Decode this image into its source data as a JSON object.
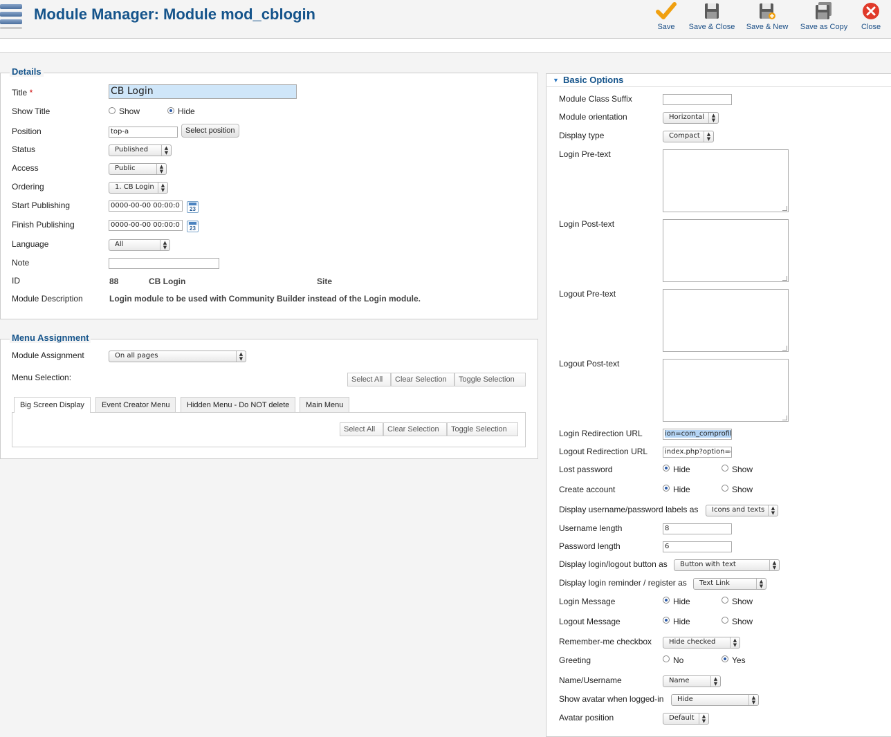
{
  "header": {
    "title": "Module Manager: Module mod_cblogin",
    "toolbar": {
      "save": "Save",
      "save_close": "Save & Close",
      "save_new": "Save & New",
      "save_copy": "Save as Copy",
      "close": "Close"
    }
  },
  "details": {
    "legend": "Details",
    "title_label": "Title",
    "required_mark": "*",
    "title_value": "CB Login",
    "show_title_label": "Show Title",
    "show_title_options": [
      "Show",
      "Hide"
    ],
    "show_title_selected": "Hide",
    "position_label": "Position",
    "position_value": "top-a",
    "select_position_button": "Select position",
    "status_label": "Status",
    "status_value": "Published",
    "access_label": "Access",
    "access_value": "Public",
    "ordering_label": "Ordering",
    "ordering_value": "1. CB Login",
    "start_publishing_label": "Start Publishing",
    "start_publishing_value": "0000-00-00 00:00:0",
    "finish_publishing_label": "Finish Publishing",
    "finish_publishing_value": "0000-00-00 00:00:0",
    "calendar_icon_text": "23",
    "language_label": "Language",
    "language_value": "All",
    "note_label": "Note",
    "note_value": "",
    "id_label": "ID",
    "id_value": "88",
    "id_name": "CB Login",
    "id_client": "Site",
    "description_label": "Module Description",
    "description_value": "Login module to be used with Community Builder instead of the Login module."
  },
  "menu_assignment": {
    "legend": "Menu Assignment",
    "module_assignment_label": "Module Assignment",
    "module_assignment_value": "On all pages",
    "menu_selection_label": "Menu Selection:",
    "select_all": "Select All",
    "clear_selection": "Clear Selection",
    "toggle_selection": "Toggle Selection",
    "tabs": [
      "Big Screen Display",
      "Event Creator Menu",
      "Hidden Menu - Do NOT delete",
      "Main Menu"
    ],
    "active_tab": "Big Screen Display"
  },
  "basic_options": {
    "legend": "Basic Options",
    "module_class_suffix_label": "Module Class Suffix",
    "module_class_suffix_value": "",
    "module_orientation_label": "Module orientation",
    "module_orientation_value": "Horizontal",
    "display_type_label": "Display type",
    "display_type_value": "Compact",
    "login_pretext_label": "Login Pre-text",
    "login_posttext_label": "Login Post-text",
    "logout_pretext_label": "Logout Pre-text",
    "logout_posttext_label": "Logout Post-text",
    "login_redirection_label": "Login Redirection URL",
    "login_redirection_value": "ion=com_comprofil",
    "logout_redirection_label": "Logout Redirection URL",
    "logout_redirection_value": "index.php?option=c",
    "lost_password_label": "Lost password",
    "create_account_label": "Create account",
    "hide_option": "Hide",
    "show_option": "Show",
    "no_option": "No",
    "yes_option": "Yes",
    "display_labels_label": "Display username/password labels as",
    "display_labels_value": "Icons and texts",
    "username_length_label": "Username length",
    "username_length_value": "8",
    "password_length_label": "Password length",
    "password_length_value": "6",
    "display_button_label": "Display login/logout button as",
    "display_button_value": "Button with text",
    "display_reminder_label": "Display login reminder / register as",
    "display_reminder_value": "Text Link",
    "login_message_label": "Login Message",
    "logout_message_label": "Logout Message",
    "remember_me_label": "Remember-me checkbox",
    "remember_me_value": "Hide checked",
    "greeting_label": "Greeting",
    "name_username_label": "Name/Username",
    "name_username_value": "Name",
    "show_avatar_label": "Show avatar when logged-in",
    "show_avatar_value": "Hide",
    "avatar_position_label": "Avatar position",
    "avatar_position_value": "Default"
  },
  "colors": {
    "title_blue": "#15548b",
    "highlight_input": "#cfe6f9",
    "close_red": "#e03a2a",
    "save_orange": "#f0a010"
  }
}
